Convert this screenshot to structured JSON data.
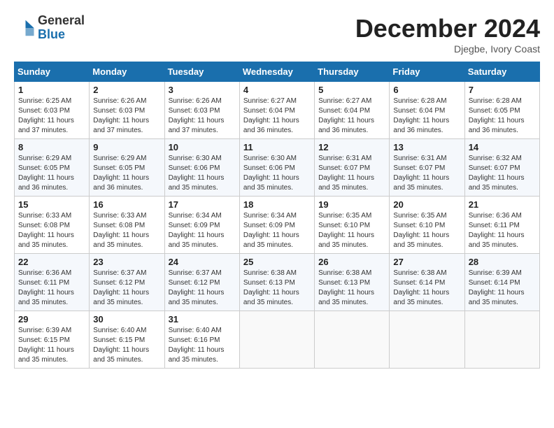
{
  "header": {
    "logo_general": "General",
    "logo_blue": "Blue",
    "month_title": "December 2024",
    "subtitle": "Djegbe, Ivory Coast"
  },
  "weekdays": [
    "Sunday",
    "Monday",
    "Tuesday",
    "Wednesday",
    "Thursday",
    "Friday",
    "Saturday"
  ],
  "weeks": [
    [
      {
        "day": "1",
        "sunrise": "6:25 AM",
        "sunset": "6:03 PM",
        "daylight": "11 hours and 37 minutes."
      },
      {
        "day": "2",
        "sunrise": "6:26 AM",
        "sunset": "6:03 PM",
        "daylight": "11 hours and 37 minutes."
      },
      {
        "day": "3",
        "sunrise": "6:26 AM",
        "sunset": "6:03 PM",
        "daylight": "11 hours and 37 minutes."
      },
      {
        "day": "4",
        "sunrise": "6:27 AM",
        "sunset": "6:04 PM",
        "daylight": "11 hours and 36 minutes."
      },
      {
        "day": "5",
        "sunrise": "6:27 AM",
        "sunset": "6:04 PM",
        "daylight": "11 hours and 36 minutes."
      },
      {
        "day": "6",
        "sunrise": "6:28 AM",
        "sunset": "6:04 PM",
        "daylight": "11 hours and 36 minutes."
      },
      {
        "day": "7",
        "sunrise": "6:28 AM",
        "sunset": "6:05 PM",
        "daylight": "11 hours and 36 minutes."
      }
    ],
    [
      {
        "day": "8",
        "sunrise": "6:29 AM",
        "sunset": "6:05 PM",
        "daylight": "11 hours and 36 minutes."
      },
      {
        "day": "9",
        "sunrise": "6:29 AM",
        "sunset": "6:05 PM",
        "daylight": "11 hours and 36 minutes."
      },
      {
        "day": "10",
        "sunrise": "6:30 AM",
        "sunset": "6:06 PM",
        "daylight": "11 hours and 35 minutes."
      },
      {
        "day": "11",
        "sunrise": "6:30 AM",
        "sunset": "6:06 PM",
        "daylight": "11 hours and 35 minutes."
      },
      {
        "day": "12",
        "sunrise": "6:31 AM",
        "sunset": "6:07 PM",
        "daylight": "11 hours and 35 minutes."
      },
      {
        "day": "13",
        "sunrise": "6:31 AM",
        "sunset": "6:07 PM",
        "daylight": "11 hours and 35 minutes."
      },
      {
        "day": "14",
        "sunrise": "6:32 AM",
        "sunset": "6:07 PM",
        "daylight": "11 hours and 35 minutes."
      }
    ],
    [
      {
        "day": "15",
        "sunrise": "6:33 AM",
        "sunset": "6:08 PM",
        "daylight": "11 hours and 35 minutes."
      },
      {
        "day": "16",
        "sunrise": "6:33 AM",
        "sunset": "6:08 PM",
        "daylight": "11 hours and 35 minutes."
      },
      {
        "day": "17",
        "sunrise": "6:34 AM",
        "sunset": "6:09 PM",
        "daylight": "11 hours and 35 minutes."
      },
      {
        "day": "18",
        "sunrise": "6:34 AM",
        "sunset": "6:09 PM",
        "daylight": "11 hours and 35 minutes."
      },
      {
        "day": "19",
        "sunrise": "6:35 AM",
        "sunset": "6:10 PM",
        "daylight": "11 hours and 35 minutes."
      },
      {
        "day": "20",
        "sunrise": "6:35 AM",
        "sunset": "6:10 PM",
        "daylight": "11 hours and 35 minutes."
      },
      {
        "day": "21",
        "sunrise": "6:36 AM",
        "sunset": "6:11 PM",
        "daylight": "11 hours and 35 minutes."
      }
    ],
    [
      {
        "day": "22",
        "sunrise": "6:36 AM",
        "sunset": "6:11 PM",
        "daylight": "11 hours and 35 minutes."
      },
      {
        "day": "23",
        "sunrise": "6:37 AM",
        "sunset": "6:12 PM",
        "daylight": "11 hours and 35 minutes."
      },
      {
        "day": "24",
        "sunrise": "6:37 AM",
        "sunset": "6:12 PM",
        "daylight": "11 hours and 35 minutes."
      },
      {
        "day": "25",
        "sunrise": "6:38 AM",
        "sunset": "6:13 PM",
        "daylight": "11 hours and 35 minutes."
      },
      {
        "day": "26",
        "sunrise": "6:38 AM",
        "sunset": "6:13 PM",
        "daylight": "11 hours and 35 minutes."
      },
      {
        "day": "27",
        "sunrise": "6:38 AM",
        "sunset": "6:14 PM",
        "daylight": "11 hours and 35 minutes."
      },
      {
        "day": "28",
        "sunrise": "6:39 AM",
        "sunset": "6:14 PM",
        "daylight": "11 hours and 35 minutes."
      }
    ],
    [
      {
        "day": "29",
        "sunrise": "6:39 AM",
        "sunset": "6:15 PM",
        "daylight": "11 hours and 35 minutes."
      },
      {
        "day": "30",
        "sunrise": "6:40 AM",
        "sunset": "6:15 PM",
        "daylight": "11 hours and 35 minutes."
      },
      {
        "day": "31",
        "sunrise": "6:40 AM",
        "sunset": "6:16 PM",
        "daylight": "11 hours and 35 minutes."
      },
      null,
      null,
      null,
      null
    ]
  ]
}
